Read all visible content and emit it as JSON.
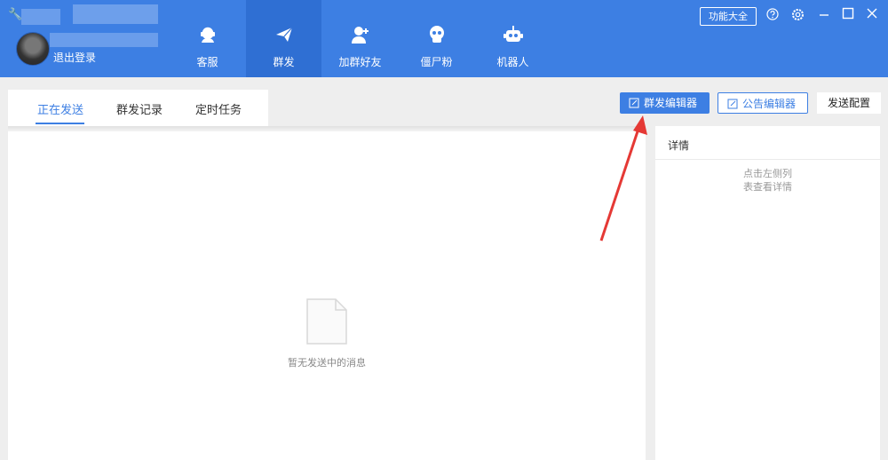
{
  "header": {
    "logout_label": "退出登录",
    "function_button": "功能大全",
    "nav": [
      {
        "label": "客服",
        "icon": "headset-icon"
      },
      {
        "label": "群发",
        "icon": "paper-plane-icon"
      },
      {
        "label": "加群好友",
        "icon": "add-user-icon"
      },
      {
        "label": "僵尸粉",
        "icon": "skull-icon"
      },
      {
        "label": "机器人",
        "icon": "robot-icon"
      }
    ],
    "active_nav": "群发"
  },
  "subtabs": [
    "正在发送",
    "群发记录",
    "定时任务"
  ],
  "active_subtab": "正在发送",
  "toolbar": {
    "mass_editor": "群发编辑器",
    "notice_editor": "公告编辑器",
    "send_config": "发送配置"
  },
  "main": {
    "empty_text": "暂无发送中的消息"
  },
  "details": {
    "title": "详情",
    "hint_line1": "点击左侧列",
    "hint_line2": "表查看详情"
  },
  "colors": {
    "primary": "#3d7fe3",
    "header": "#3d7fe3",
    "active_nav": "#2f6fd3",
    "annotation_arrow": "#e53935"
  }
}
